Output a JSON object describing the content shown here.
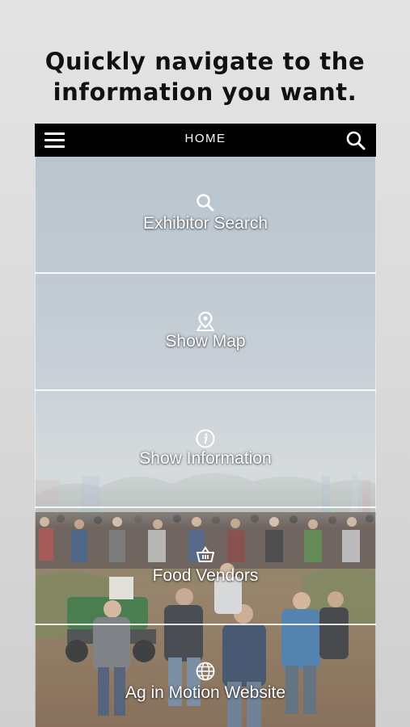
{
  "headline": {
    "line1": "Quickly navigate to the",
    "line2": "information you want."
  },
  "navbar": {
    "title": "HOME",
    "menu_icon": "hamburger-menu-icon",
    "search_icon": "search-icon"
  },
  "menu": [
    {
      "label": "Exhibitor Search",
      "icon": "search-icon"
    },
    {
      "label": "Show Map",
      "icon": "map-pin-icon"
    },
    {
      "label": "Show Information",
      "icon": "info-icon"
    },
    {
      "label": "Food Vendors",
      "icon": "basket-icon"
    },
    {
      "label": "Ag in Motion Website",
      "icon": "globe-icon"
    }
  ],
  "colors": {
    "navbar_bg": "#000000",
    "sky": "#c9d2da",
    "ground": "#8a6a4c",
    "text": "#ffffff"
  }
}
